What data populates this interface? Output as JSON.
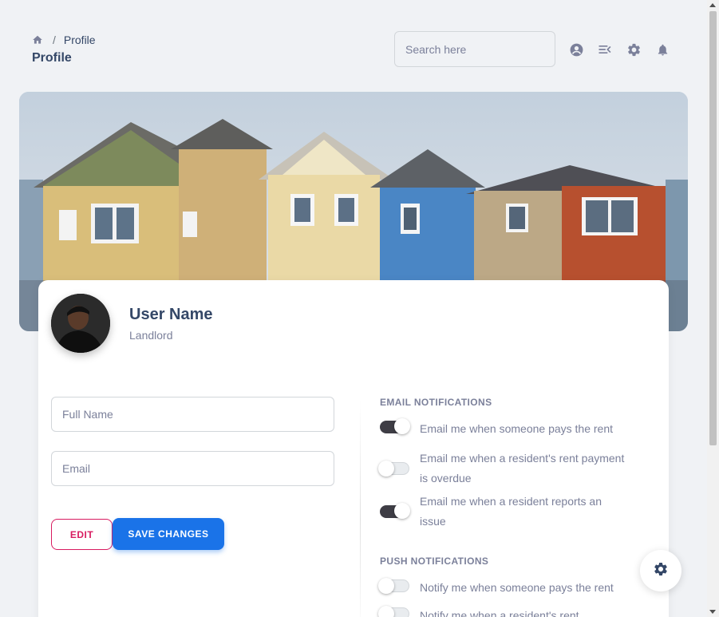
{
  "breadcrumb": {
    "home_icon": "home-icon",
    "separator": "/",
    "current": "Profile"
  },
  "page_title": "Profile",
  "search": {
    "placeholder": "Search here",
    "value": ""
  },
  "header_icons": [
    "account-circle-icon",
    "menu-open-icon",
    "gear-icon",
    "bell-icon"
  ],
  "banner": {
    "description_icon": "houses-banner-image"
  },
  "profile": {
    "name": "User Name",
    "role": "Landlord"
  },
  "form": {
    "full_name_placeholder": "Full Name",
    "email_placeholder": "Email",
    "edit_label": "EDIT",
    "save_label": "SAVE CHANGES"
  },
  "email_notifications": {
    "heading": "EMAIL NOTIFICATIONS",
    "items": [
      {
        "label": "Email me when someone pays the rent",
        "on": true
      },
      {
        "label": "Email me when a resident's rent payment is overdue",
        "on": false
      },
      {
        "label": "Email me when a resident reports an issue",
        "on": true
      }
    ]
  },
  "push_notifications": {
    "heading": "PUSH NOTIFICATIONS",
    "items": [
      {
        "label": "Notify me when someone pays the rent",
        "on": false
      },
      {
        "label": "Notify me when a resident's rent",
        "on": false
      }
    ]
  },
  "colors": {
    "primary": "#1a73e8",
    "edit": "#d81b60",
    "toggle_on": "#3e3d45",
    "text": "#344767",
    "muted": "#7b809a"
  }
}
